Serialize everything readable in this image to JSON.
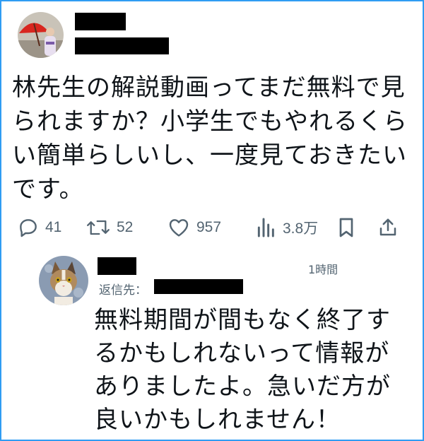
{
  "tweet": {
    "text": "林先生の解説動画ってまだ無料で見られますか？小学生でもやれるくらい簡単らしいし、一度見ておきたいです。",
    "avatar_icon": "user-photo-umbrella"
  },
  "actions": {
    "reply_count": "41",
    "retweet_count": "52",
    "like_count": "957",
    "view_count": "3.8万",
    "icons": [
      "reply-icon",
      "retweet-icon",
      "like-icon",
      "views-icon",
      "bookmark-icon",
      "share-icon"
    ]
  },
  "reply": {
    "time": "1時間",
    "reply_to_label": "返信先：",
    "text": "無料期間が間もなく終了するかもしれないって情報がありましたよ。急いだ方が良いかもしれません！",
    "avatar_icon": "cat-avatar"
  },
  "colors": {
    "border": "#2f9cf3",
    "icon": "#536471",
    "text": "#0f1419"
  }
}
